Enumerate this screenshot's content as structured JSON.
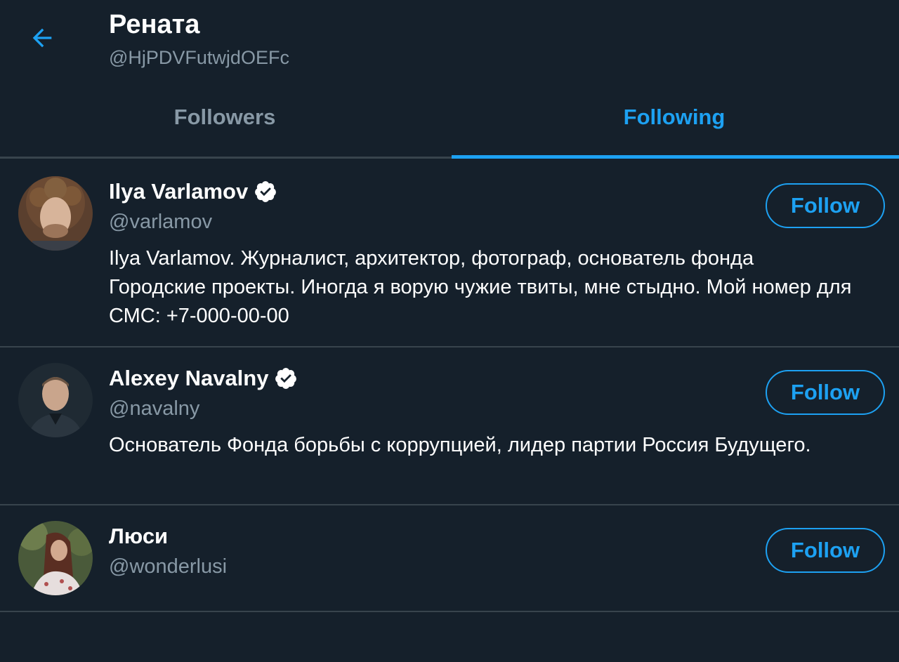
{
  "header": {
    "title": "Рената",
    "handle": "@HjPDVFutwjdOEFc",
    "back_icon": "arrow-left-icon"
  },
  "tabs": [
    {
      "label": "Followers",
      "active": false
    },
    {
      "label": "Following",
      "active": true
    }
  ],
  "colors": {
    "background": "#15202b",
    "accent": "#1da1f2",
    "muted": "#8899a6",
    "divider": "#38444d"
  },
  "users": [
    {
      "name": "Ilya Varlamov",
      "verified": true,
      "handle": "@varlamov",
      "bio": "Ilya Varlamov. Журналист, архитектор, фотограф, основатель фонда Городские проекты. Иногда я ворую чужие твиты, мне стыдно. Мой номер для СМС: +7-000-00-00",
      "follow_label": "Follow"
    },
    {
      "name": "Alexey Navalny",
      "verified": true,
      "handle": "@navalny",
      "bio": "Основатель Фонда борьбы с коррупцией, лидер партии Россия Будущего.",
      "follow_label": "Follow"
    },
    {
      "name": "Люси",
      "verified": false,
      "handle": "@wonderlusi",
      "bio": "",
      "follow_label": "Follow"
    }
  ]
}
